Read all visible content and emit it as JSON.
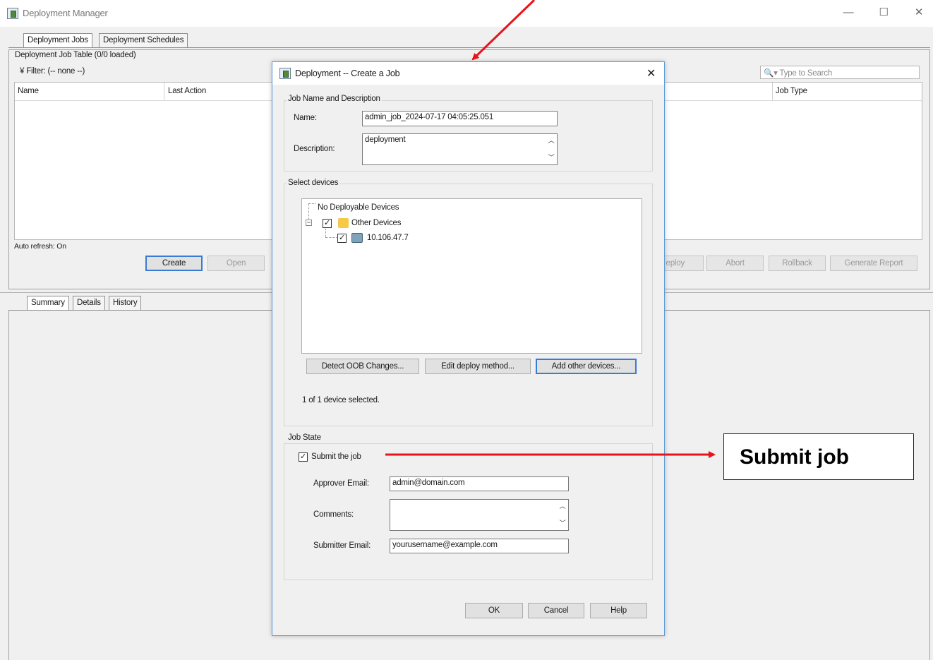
{
  "window": {
    "title": "Deployment Manager",
    "minimize": "—",
    "maximize": "☐",
    "close": "✕"
  },
  "main_tabs": [
    "Deployment Jobs",
    "Deployment Schedules"
  ],
  "job_table": {
    "caption": "Deployment Job Table (0/0 loaded)",
    "filter_label": "Filter: (-- none --)",
    "search_placeholder": "Type to Search",
    "columns": [
      "Name",
      "Last Action",
      "Job Type"
    ],
    "auto_refresh": "Auto refresh: On"
  },
  "action_buttons": {
    "create": "Create",
    "open": "Open",
    "deploy": "eploy",
    "abort": "Abort",
    "rollback": "Rollback",
    "generate_report": "Generate Report"
  },
  "detail_tabs": [
    "Summary",
    "Details",
    "History"
  ],
  "dialog": {
    "title": "Deployment -- Create a Job",
    "close": "✕",
    "job_group": {
      "label": "Job Name and Description",
      "name_label": "Name:",
      "name_value": "admin_job_2024-07-17 04:05:25.051",
      "description_label": "Description:",
      "description_value": "deployment"
    },
    "devices_group": {
      "label": "Select devices",
      "tree": {
        "root": "No Deployable Devices",
        "folder": "Other Devices",
        "device": "10.106.47.7"
      },
      "buttons": {
        "detect": "Detect OOB Changes...",
        "edit": "Edit deploy method...",
        "add": "Add other devices..."
      },
      "selection_status": "1 of 1 device selected."
    },
    "state_group": {
      "label": "Job State",
      "submit_label": "Submit the job",
      "submit_checked": true,
      "approver_label": "Approver Email:",
      "approver_value": "admin@domain.com",
      "comments_label": "Comments:",
      "comments_value": "",
      "submitter_label": "Submitter Email:",
      "submitter_value": "yourusername@example.com"
    },
    "footer": {
      "ok": "OK",
      "cancel": "Cancel",
      "help": "Help"
    }
  },
  "annotation": {
    "callout_text": "Submit job",
    "arrow_color": "#e8141b"
  }
}
